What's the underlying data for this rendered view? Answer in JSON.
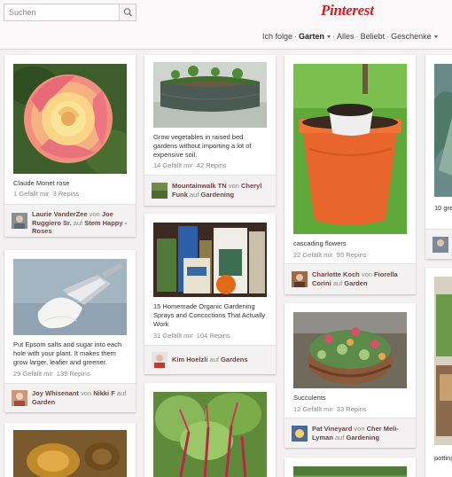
{
  "search": {
    "placeholder": "Suchen",
    "icon": "search-icon"
  },
  "logo": "Pinterest",
  "nav": {
    "items": [
      "Ich folge",
      "Garten",
      "Alles",
      "Beliebt",
      "Geschenke"
    ],
    "separators": [
      "·",
      "·",
      "·",
      "·"
    ]
  },
  "pins": [
    {
      "description": "Claude Monet rose",
      "likes": "1 Gefällt mir",
      "repins": "3 Repins",
      "user": "Laurie VanderZee",
      "von": "von",
      "via": "Joe Ruggiero Sr.",
      "auf": "auf",
      "board": "Stem Happy - Roses"
    },
    {
      "description": "Put Epsom salts and sugar into each hole with your plant. It makes them grow larger, leafier and greener.",
      "likes": "29 Gefällt mir",
      "repins": "139 Repins",
      "user": "Joy Whisenant",
      "von": "von",
      "via": "Nikki F",
      "auf": "auf",
      "board": "Garden"
    },
    {
      "description": "Grow vegetables in raised bed gardens without importing a lot of expensive soil.",
      "likes": "14 Gefällt mir",
      "repins": "42 Repins",
      "user": "Mountainwalk TN",
      "von": "von",
      "via": "Cheryl Funk",
      "auf": "auf",
      "board": "Gardening"
    },
    {
      "description": "15 Homemade Organic Gardening Sprays and Concoctions That Actually Work",
      "likes": "31 Gefällt mir",
      "repins": "104 Repins",
      "user": "Kim Hoelzli",
      "auf": "auf",
      "board": "Gardens"
    },
    {
      "description": "cascading flowers",
      "likes": "22 Gefällt mir",
      "repins": "95 Repins",
      "user": "Charlotte Koch",
      "von": "von",
      "via": "Fiorella Corini",
      "auf": "auf",
      "board": "Garden"
    },
    {
      "description": "Succulents",
      "likes": "12 Gefällt mir",
      "repins": "33 Repins",
      "user": "Pat Vineyard",
      "von": "von",
      "via": "Cher Meli-Lyman",
      "auf": "auf",
      "board": "Gardening"
    },
    {
      "description": "10 gre"
    },
    {
      "description": "potting"
    }
  ]
}
